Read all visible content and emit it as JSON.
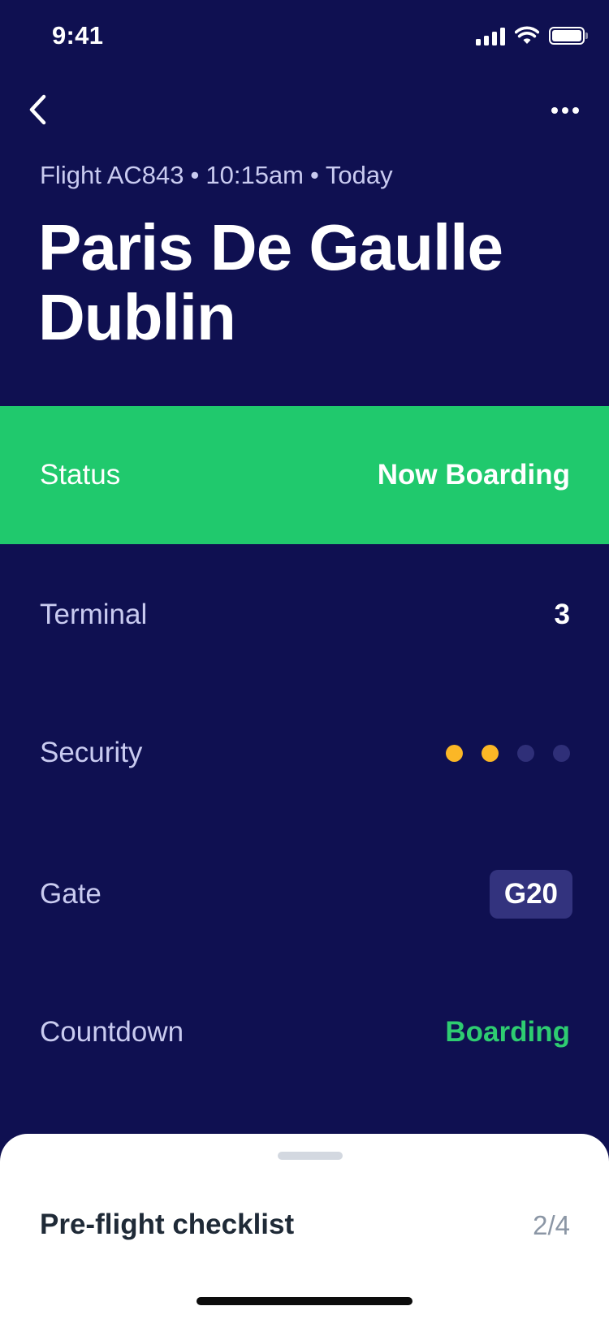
{
  "status_bar": {
    "time": "9:41",
    "icons": [
      "signal-icon",
      "wifi-icon",
      "battery-icon"
    ]
  },
  "nav": {
    "back_icon": "chevron-left-icon",
    "more_icon": "more-horizontal-icon"
  },
  "flight": {
    "number": "Flight AC843",
    "separator": "•",
    "time": "10:15am",
    "day": "Today",
    "origin": "Paris De Gaulle",
    "destination": "Dublin"
  },
  "details": {
    "status": {
      "label": "Status",
      "value": "Now Boarding"
    },
    "terminal": {
      "label": "Terminal",
      "value": "3"
    },
    "security": {
      "label": "Security",
      "level": 2,
      "max": 4
    },
    "gate": {
      "label": "Gate",
      "value": "G20"
    },
    "countdown": {
      "label": "Countdown",
      "value": "Boarding"
    }
  },
  "checklist": {
    "title": "Pre-flight checklist",
    "progress": "2/4"
  },
  "colors": {
    "background": "#0f1051",
    "status_green": "#20c96d",
    "countdown_green": "#2ecc71",
    "security_active": "#fbb726",
    "security_inactive": "#2f2f78",
    "gate_badge": "#33337e",
    "label_text": "#c9cbf0"
  }
}
